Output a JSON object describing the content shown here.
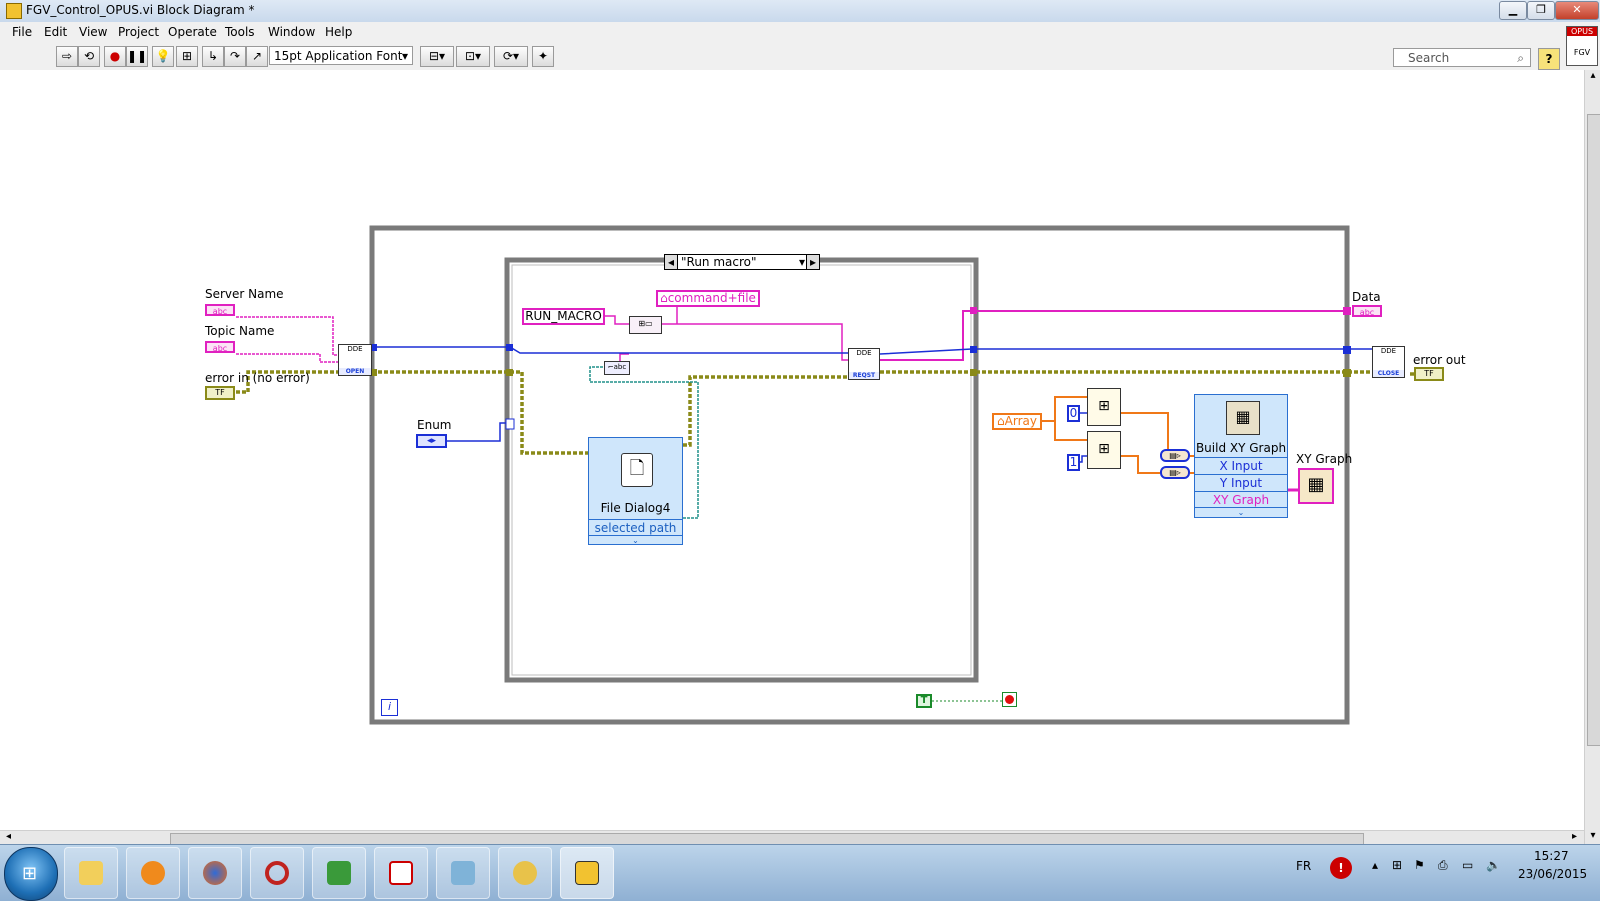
{
  "window": {
    "title": "FGV_Control_OPUS.vi Block Diagram *",
    "minimize": "0",
    "maximize": "1",
    "close": "r"
  },
  "menu": [
    "File",
    "Edit",
    "View",
    "Project",
    "Operate",
    "Tools",
    "Window",
    "Help"
  ],
  "toolbar": {
    "font_label": "15pt Application Font",
    "search_placeholder": "Search",
    "help": "?",
    "vi_icon_top": "OPUS",
    "vi_icon_bottom": "FGV"
  },
  "diagram": {
    "server_name_label": "Server Name",
    "topic_name_label": "Topic Name",
    "error_in_label": "error in (no error)",
    "enum_label": "Enum",
    "data_label": "Data",
    "error_out_label": "error out",
    "xy_graph_label": "XY Graph",
    "case_selector": "\"Run macro\"",
    "run_macro_const": "RUN_MACRO",
    "command_file_local": "command+file",
    "file_dialog_title": "File Dialog4",
    "file_dialog_output": "selected path",
    "array_local": "Array",
    "index0": "0",
    "index1": "1",
    "build_xy_title": "Build XY Graph",
    "build_xy_x": "X Input",
    "build_xy_y": "Y Input",
    "build_xy_out": "XY Graph",
    "loop_iteration": "i",
    "true_const": "T",
    "subvi_open": "OPEN",
    "subvi_reqst": "REQST",
    "subvi_close": "CLOSE",
    "subvi_dde": "DDE",
    "abc_text": "abc",
    "cluster_text": "TF"
  },
  "taskbar": {
    "lang": "FR",
    "time": "15:27",
    "date": "23/06/2015"
  },
  "colors": {
    "string_wire": "#e020c0",
    "dde_wire": "#1b2fd6",
    "error_wire": "#8a8a18",
    "path_wire": "#20908a",
    "numeric_wire": "#f07818",
    "boolean_wire": "#1a8a2a"
  }
}
